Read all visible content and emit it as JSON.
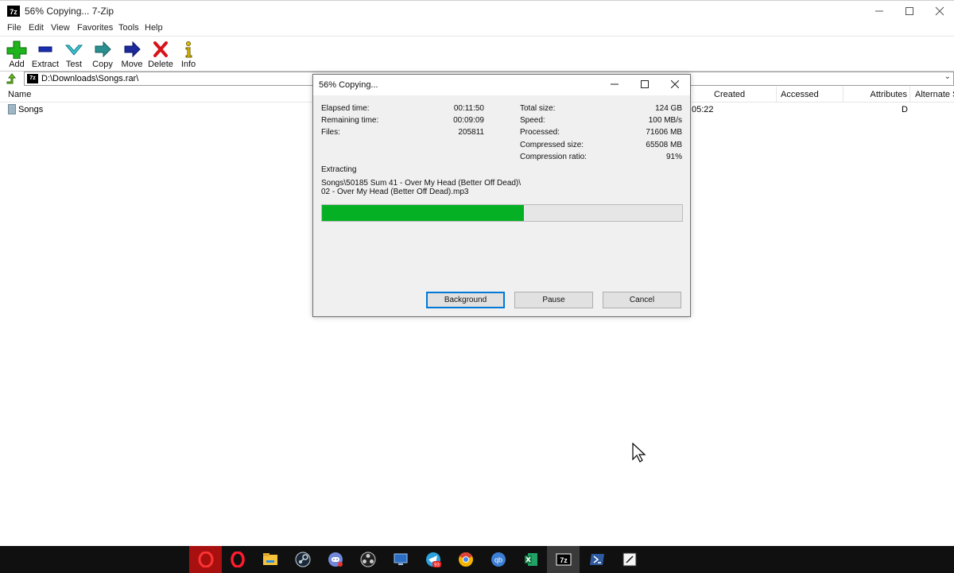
{
  "window": {
    "title": "56% Copying... 7-Zip",
    "app_icon": "7z",
    "controls": [
      "minimize-icon",
      "maximize-icon",
      "close-icon"
    ]
  },
  "menu": [
    "File",
    "Edit",
    "View",
    "Favorites",
    "Tools",
    "Help"
  ],
  "toolbar": {
    "add": "Add",
    "extract": "Extract",
    "test": "Test",
    "copy": "Copy",
    "move": "Move",
    "delete": "Delete",
    "info": "Info"
  },
  "address": {
    "icon": "7z",
    "path": "D:\\Downloads\\Songs.rar\\"
  },
  "columns": {
    "name": "Name",
    "created": "Created",
    "accessed": "Accessed",
    "attributes": "Attributes",
    "alternate": "Alternate S"
  },
  "rows": [
    {
      "name": "Songs",
      "modified": "05:22",
      "attributes": "D"
    }
  ],
  "dialog": {
    "title": "56% Copying...",
    "elapsed_label": "Elapsed time:",
    "elapsed": "00:11:50",
    "remaining_label": "Remaining time:",
    "remaining": "00:09:09",
    "files_label": "Files:",
    "files": "205811",
    "total_label": "Total size:",
    "total": "124 GB",
    "speed_label": "Speed:",
    "speed": "100 MB/s",
    "processed_label": "Processed:",
    "processed": "71606 MB",
    "compressed_label": "Compressed size:",
    "compressed": "65508 MB",
    "ratio_label": "Compression ratio:",
    "ratio": "91%",
    "operation": "Extracting",
    "file_line1": "Songs\\50185 Sum 41 - Over My Head (Better Off Dead)\\",
    "file_line2": "02 - Over My Head (Better Off Dead).mp3",
    "progress_percent": 56,
    "background_btn": "Background",
    "pause_btn": "Pause",
    "cancel_btn": "Cancel"
  },
  "taskbar": {
    "apps": [
      "opera-gx-icon",
      "opera-icon",
      "file-explorer-icon",
      "steam-icon",
      "discord-icon",
      "obs-icon",
      "remote-desktop-icon",
      "telegram-icon",
      "chrome-icon",
      "qbittorrent-icon",
      "excel-icon",
      "7zip-icon",
      "powershell-icon",
      "notepad-icon"
    ],
    "telegram_badge": "93",
    "qbittorrent_label": "qb",
    "sevenzip_label": "7z"
  },
  "colors": {
    "progress": "#06b025",
    "taskbar": "#101010",
    "accent": "#0078d7"
  }
}
